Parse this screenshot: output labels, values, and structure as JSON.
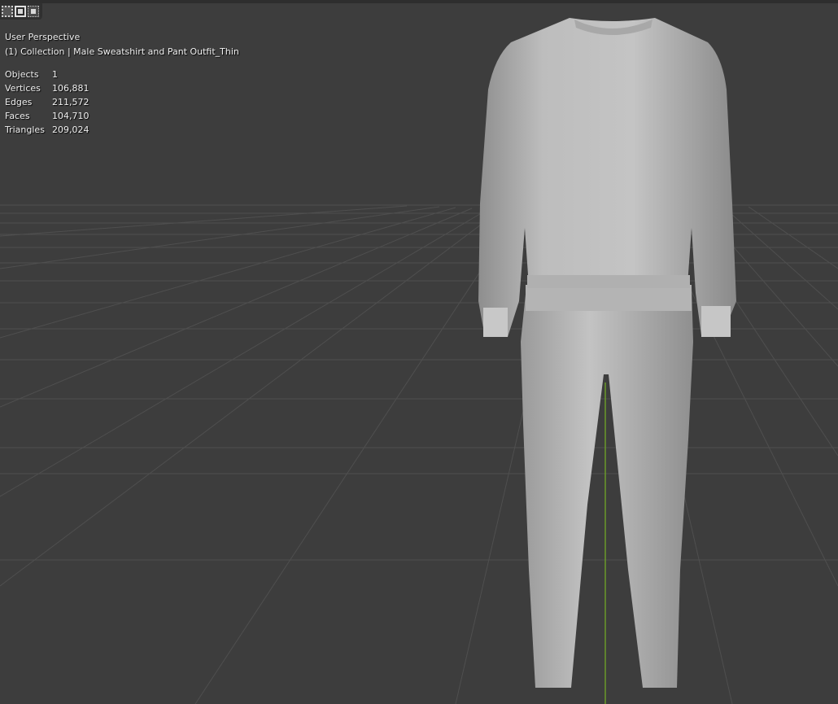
{
  "viewport": {
    "view_name": "User Perspective",
    "collection_line": "(1) Collection | Male Sweatshirt and Pant Outfit_Thin",
    "background_color": "#3d3d3d",
    "grid_color": "#505050",
    "y_axis_color": "#6a9a2a",
    "model_color": "#bdbdbd"
  },
  "select_modes": [
    {
      "name": "vertex-select-mode-icon"
    },
    {
      "name": "edge-select-mode-icon"
    },
    {
      "name": "face-select-mode-icon"
    }
  ],
  "stats": [
    {
      "label": "Objects",
      "value": "1"
    },
    {
      "label": "Vertices",
      "value": "106,881"
    },
    {
      "label": "Edges",
      "value": "211,572"
    },
    {
      "label": "Faces",
      "value": "104,710"
    },
    {
      "label": "Triangles",
      "value": "209,024"
    }
  ]
}
